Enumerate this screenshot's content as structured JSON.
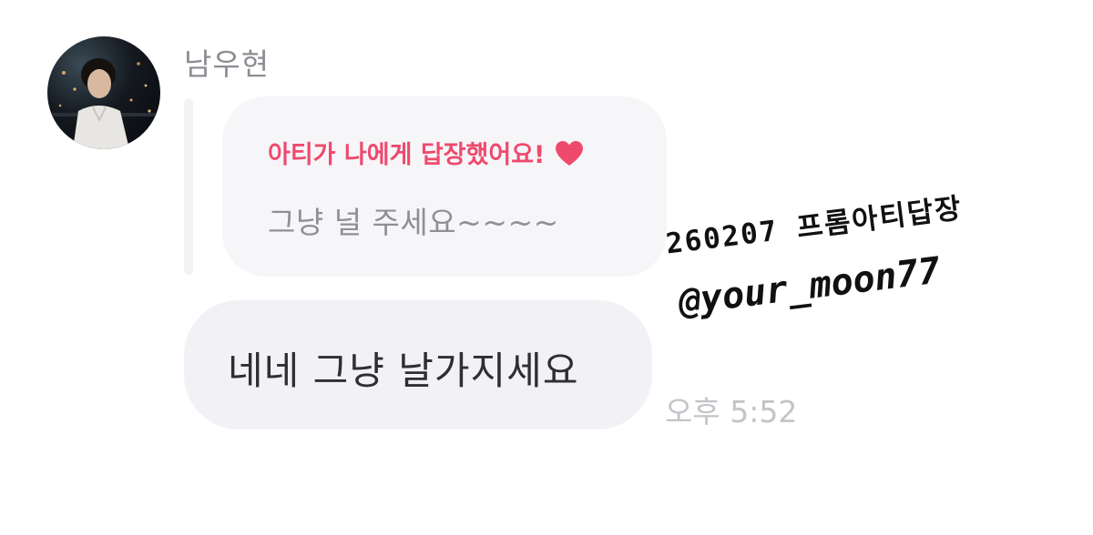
{
  "sender": {
    "name": "남우현",
    "avatar_icon": "profile-photo"
  },
  "reply": {
    "header": "아티가 나에게 답장했어요!",
    "header_color": "#ef4a6d",
    "heart_icon": "heart-icon",
    "quoted_text": "그냥 널 주세요~~~~"
  },
  "message": {
    "text": "네네 그냥 날가지세요",
    "timestamp": "오후 5:52"
  },
  "watermark": {
    "line1": "260207 프롬아티답장",
    "line2": "@your_moon77"
  }
}
